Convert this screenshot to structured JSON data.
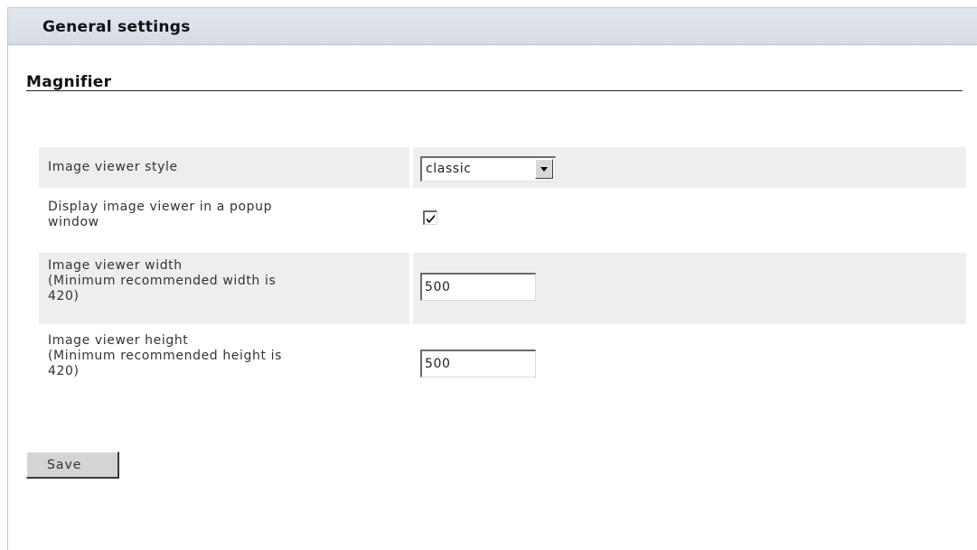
{
  "header": {
    "title": "General settings"
  },
  "section": {
    "title": "Magnifier"
  },
  "settings": {
    "viewer_style": {
      "label": "Image viewer style",
      "selected": "classic"
    },
    "popup": {
      "label_line1": "Display image viewer in a popup",
      "label_line2": "window",
      "checked": true
    },
    "width": {
      "label_line1": "Image viewer width",
      "label_line2": "(Minimum recommended width is",
      "label_line3": "420)",
      "value": "500"
    },
    "height": {
      "label_line1": "Image viewer height",
      "label_line2": "(Minimum recommended height is",
      "label_line3": "420)",
      "value": "500"
    }
  },
  "actions": {
    "save_label": "Save"
  },
  "colors": {
    "header_bg": "#dde1ea",
    "row_shade": "#eeeeee",
    "button_bg": "#d4d4d4"
  },
  "icons": {
    "select_arrow": "chevron-down-icon",
    "checkmark": "checkmark-icon"
  }
}
